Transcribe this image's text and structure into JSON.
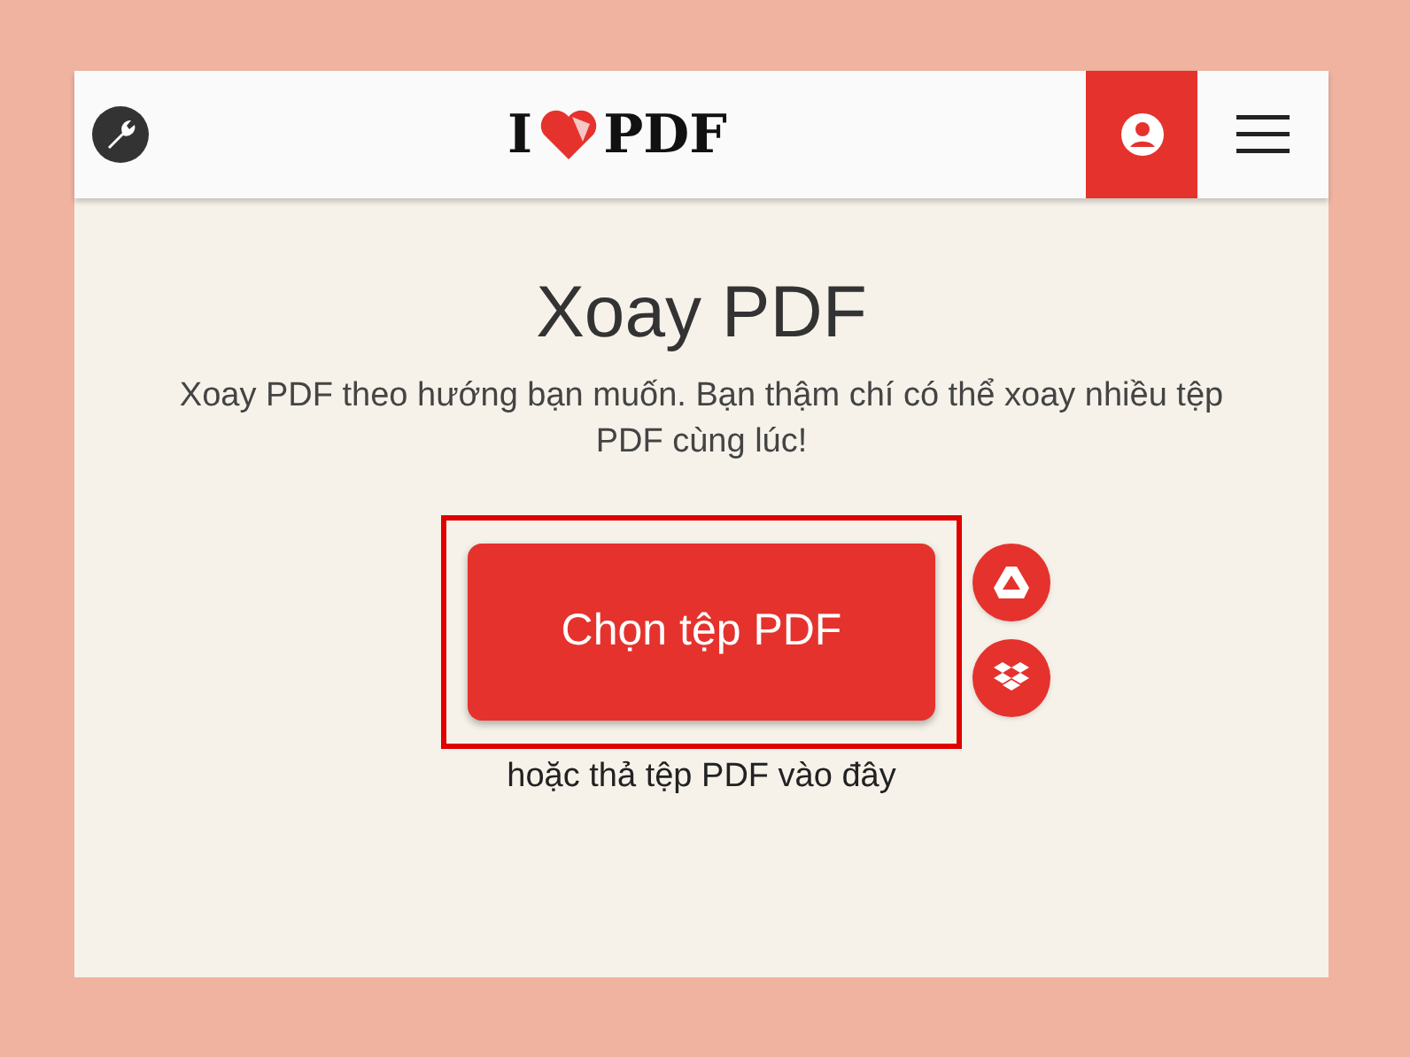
{
  "header": {
    "logo": {
      "left": "I",
      "right": "PDF"
    },
    "account_selected": true
  },
  "title": "Xoay PDF",
  "description": "Xoay PDF theo hướng bạn muốn. Bạn thậm chí có thể xoay nhiều tệp PDF cùng lúc!",
  "upload": {
    "button": "Chọn tệp PDF",
    "highlighted": true,
    "drop_hint": "hoặc thả tệp PDF vào đây"
  }
}
